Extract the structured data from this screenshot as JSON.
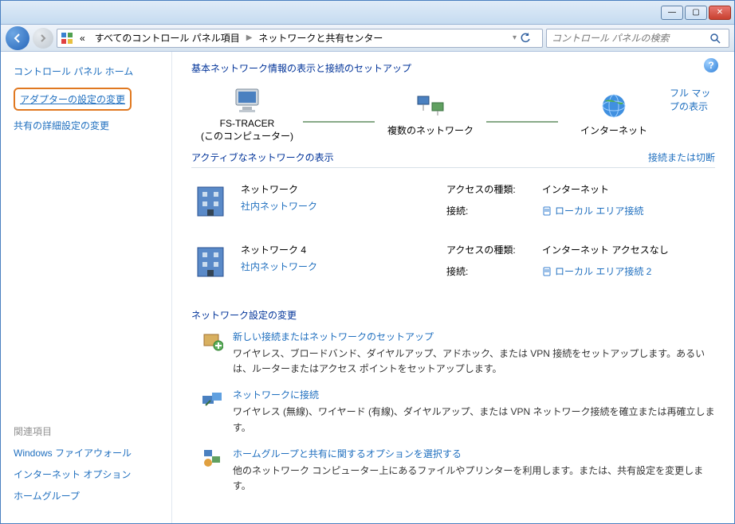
{
  "titlebar": {
    "min": "—",
    "max": "▢",
    "close": "✕"
  },
  "nav": {
    "breadcrumb_prefix": "«",
    "crumb1": "すべてのコントロール パネル項目",
    "crumb2": "ネットワークと共有センター",
    "search_placeholder": "コントロール パネルの検索"
  },
  "sidebar": {
    "home": "コントロール パネル ホーム",
    "adapter": "アダプターの設定の変更",
    "advanced": "共有の詳細設定の変更",
    "related_head": "関連項目",
    "related": {
      "firewall": "Windows ファイアウォール",
      "inet": "インターネット オプション",
      "homegroup": "ホームグループ"
    }
  },
  "main": {
    "title": "基本ネットワーク情報の表示と接続のセットアップ",
    "map": {
      "node1_name": "FS-TRACER",
      "node1_sub": "(このコンピューター)",
      "node2_name": "複数のネットワーク",
      "node3_name": "インターネット",
      "full_map": "フル マップの表示"
    },
    "active_head": "アクティブなネットワークの表示",
    "connect_disconnect": "接続または切断",
    "nets": [
      {
        "name": "ネットワーク",
        "type": "社内ネットワーク",
        "k1": "アクセスの種類:",
        "v1": "インターネット",
        "k2": "接続:",
        "v2": "ローカル エリア接続"
      },
      {
        "name": "ネットワーク 4",
        "type": "社内ネットワーク",
        "k1": "アクセスの種類:",
        "v1": "インターネット アクセスなし",
        "k2": "接続:",
        "v2": "ローカル エリア接続 2"
      }
    ],
    "settings_head": "ネットワーク設定の変更",
    "settings": [
      {
        "t": "新しい接続またはネットワークのセットアップ",
        "d": "ワイヤレス、ブロードバンド、ダイヤルアップ、アドホック、または VPN 接続をセットアップします。あるいは、ルーターまたはアクセス ポイントをセットアップします。"
      },
      {
        "t": "ネットワークに接続",
        "d": "ワイヤレス (無線)、ワイヤード (有線)、ダイヤルアップ、または VPN ネットワーク接続を確立または再確立します。"
      },
      {
        "t": "ホームグループと共有に関するオプションを選択する",
        "d": "他のネットワーク コンピューター上にあるファイルやプリンターを利用します。または、共有設定を変更します。"
      }
    ]
  }
}
